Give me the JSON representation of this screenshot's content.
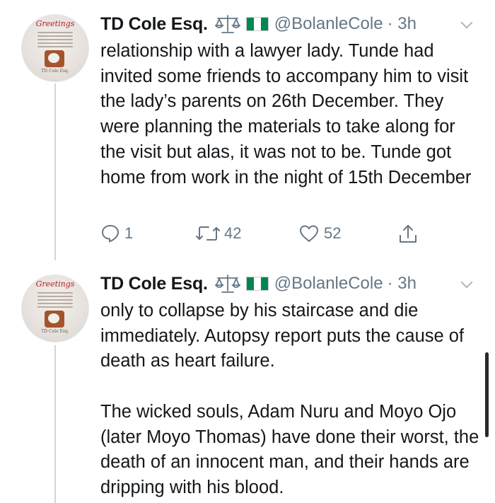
{
  "tweets": [
    {
      "author_name": "TD Cole Esq.",
      "handle": "@BolanleCole",
      "time": "· 3h",
      "avatar": {
        "greeting": "Greetings",
        "signature": "TD Cole Esq."
      },
      "text": "relationship with a lawyer lady. Tunde had invited some friends to accompany him to visit the lady’s parents on 26th December. They were planning the materials to take along for the visit but alas, it was not to be. Tunde got home from work in the night of 15th December",
      "replies": "1",
      "retweets": "42",
      "likes": "52"
    },
    {
      "author_name": "TD Cole Esq.",
      "handle": "@BolanleCole",
      "time": "· 3h",
      "avatar": {
        "greeting": "Greetings",
        "signature": "TD Cole Esq."
      },
      "text": "only to collapse by his staircase and die immediately. Autopsy report puts the cause of death as heart failure.\n\nThe wicked souls, Adam Nuru and Moyo Ojo (later Moyo Thomas) have done their worst, the death of an innocent man, and their hands are dripping with his blood."
    }
  ],
  "colors": {
    "muted": "#657786",
    "flag_green": "#008751",
    "greeting_red": "#b51f2a"
  },
  "icons": [
    "scales-emoji",
    "nigeria-flag",
    "chevron-down-icon",
    "reply-icon",
    "retweet-icon",
    "like-icon",
    "share-icon"
  ]
}
